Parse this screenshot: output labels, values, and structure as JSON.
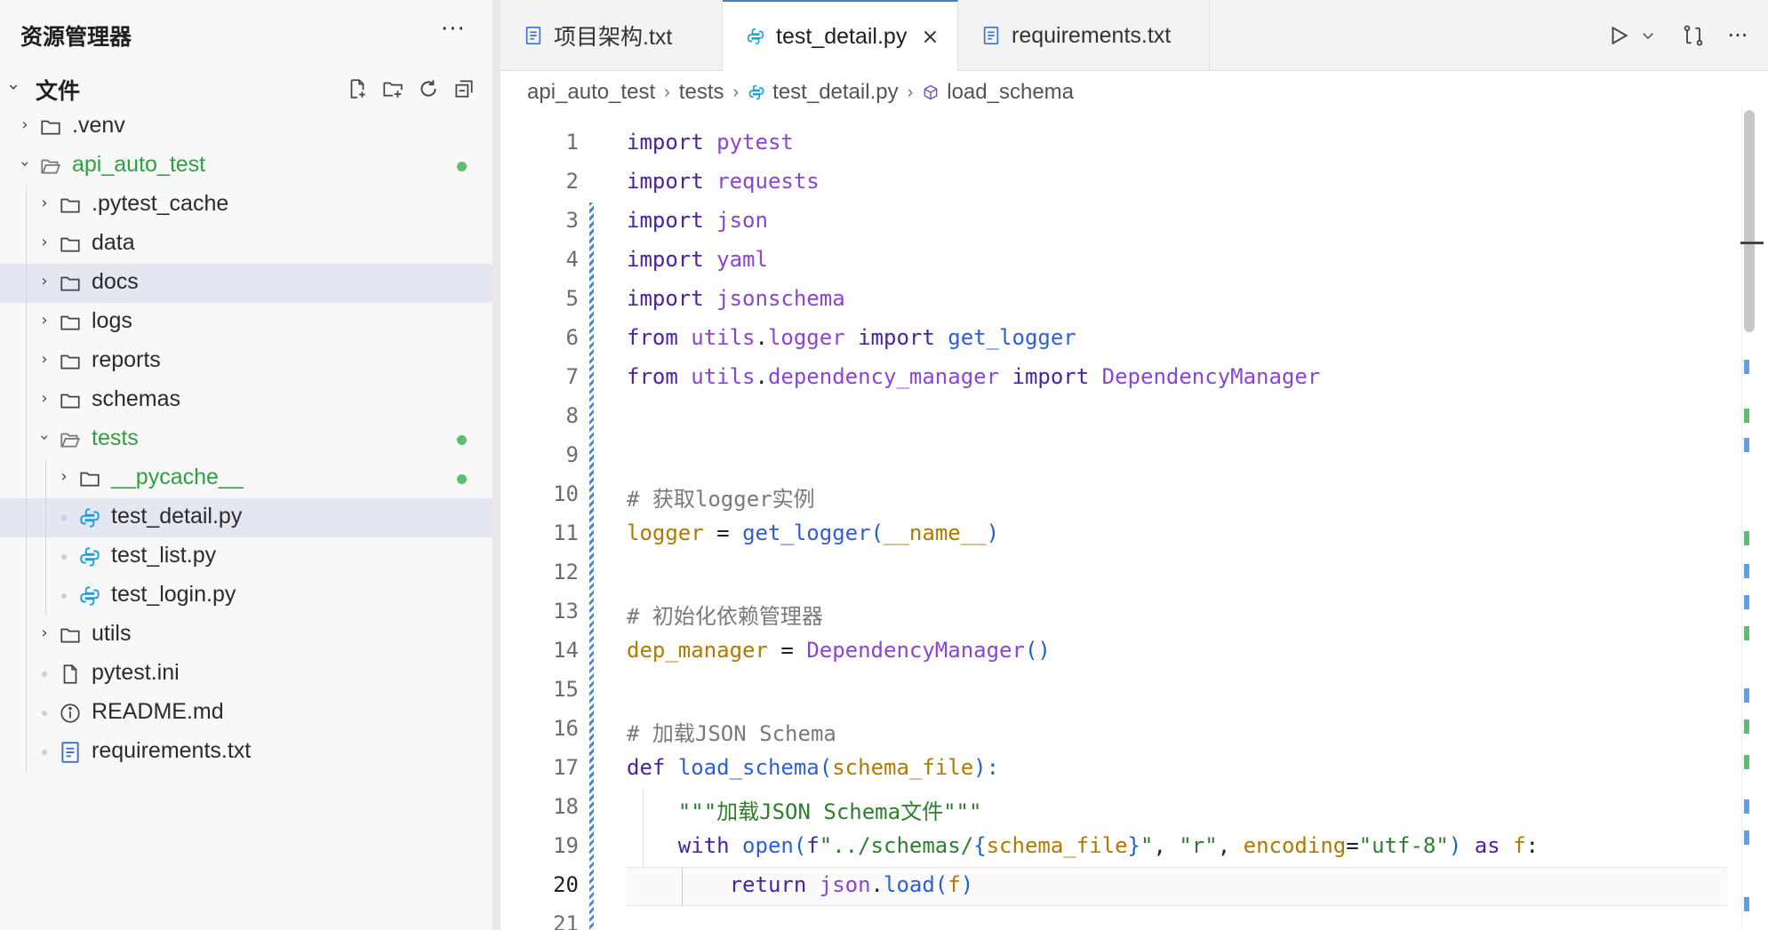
{
  "explorer": {
    "title": "资源管理器",
    "more": "···",
    "section_title": "文件",
    "actions": [
      "new-file",
      "new-folder",
      "refresh",
      "collapse-all"
    ]
  },
  "tree": [
    {
      "label": ".venv",
      "type": "folder",
      "depth": 0,
      "expanded": false,
      "status": false,
      "green": false
    },
    {
      "label": "api_auto_test",
      "type": "folder-open",
      "depth": 0,
      "expanded": true,
      "status": true,
      "green": true
    },
    {
      "label": ".pytest_cache",
      "type": "folder",
      "depth": 1,
      "expanded": false,
      "status": false,
      "green": false
    },
    {
      "label": "data",
      "type": "folder",
      "depth": 1,
      "expanded": false,
      "status": false,
      "green": false
    },
    {
      "label": "docs",
      "type": "folder",
      "depth": 1,
      "expanded": false,
      "status": false,
      "green": false,
      "selected": true
    },
    {
      "label": "logs",
      "type": "folder",
      "depth": 1,
      "expanded": false,
      "status": false,
      "green": false
    },
    {
      "label": "reports",
      "type": "folder",
      "depth": 1,
      "expanded": false,
      "status": false,
      "green": false
    },
    {
      "label": "schemas",
      "type": "folder",
      "depth": 1,
      "expanded": false,
      "status": false,
      "green": false
    },
    {
      "label": "tests",
      "type": "folder-open",
      "depth": 1,
      "expanded": true,
      "status": true,
      "green": true
    },
    {
      "label": "__pycache__",
      "type": "folder",
      "depth": 2,
      "expanded": false,
      "status": true,
      "green": true
    },
    {
      "label": "test_detail.py",
      "type": "python",
      "depth": 2,
      "status": false,
      "green": false,
      "selected": true
    },
    {
      "label": "test_list.py",
      "type": "python",
      "depth": 2,
      "status": false,
      "green": false
    },
    {
      "label": "test_login.py",
      "type": "python",
      "depth": 2,
      "status": false,
      "green": false
    },
    {
      "label": "utils",
      "type": "folder",
      "depth": 1,
      "expanded": false,
      "status": false,
      "green": false
    },
    {
      "label": "pytest.ini",
      "type": "file",
      "depth": 1,
      "status": false,
      "green": false
    },
    {
      "label": "README.md",
      "type": "info",
      "depth": 1,
      "status": false,
      "green": false
    },
    {
      "label": "requirements.txt",
      "type": "text",
      "depth": 1,
      "status": false,
      "green": false
    }
  ],
  "tabs": [
    {
      "label": "项目架构.txt",
      "icon": "text-file-icon",
      "active": false
    },
    {
      "label": "test_detail.py",
      "icon": "python-icon",
      "active": true,
      "close": "×"
    },
    {
      "label": "requirements.txt",
      "icon": "text-file-icon",
      "active": false
    }
  ],
  "breadcrumb": [
    {
      "label": "api_auto_test",
      "icon": ""
    },
    {
      "label": "tests",
      "icon": ""
    },
    {
      "label": "test_detail.py",
      "icon": "python-icon"
    },
    {
      "label": "load_schema",
      "icon": "cube-icon"
    }
  ],
  "editor": {
    "current_line": 20,
    "lines": [
      {
        "n": "1",
        "toks": [
          [
            "import",
            "k"
          ],
          [
            " ",
            "p"
          ],
          [
            "pytest",
            "m"
          ]
        ]
      },
      {
        "n": "2",
        "toks": [
          [
            "import",
            "k"
          ],
          [
            " ",
            "p"
          ],
          [
            "requests",
            "m"
          ]
        ]
      },
      {
        "n": "3",
        "toks": [
          [
            "import",
            "k"
          ],
          [
            " ",
            "p"
          ],
          [
            "json",
            "m"
          ]
        ]
      },
      {
        "n": "4",
        "toks": [
          [
            "import",
            "k"
          ],
          [
            " ",
            "p"
          ],
          [
            "yaml",
            "m"
          ]
        ]
      },
      {
        "n": "5",
        "toks": [
          [
            "import",
            "k"
          ],
          [
            " ",
            "p"
          ],
          [
            "jsonschema",
            "m"
          ]
        ]
      },
      {
        "n": "6",
        "toks": [
          [
            "from",
            "k"
          ],
          [
            " ",
            "p"
          ],
          [
            "utils",
            "m"
          ],
          [
            ".",
            "p"
          ],
          [
            "logger",
            "m"
          ],
          [
            " ",
            "p"
          ],
          [
            "import",
            "k"
          ],
          [
            " ",
            "p"
          ],
          [
            "get_logger",
            "f"
          ]
        ]
      },
      {
        "n": "7",
        "toks": [
          [
            "from",
            "k"
          ],
          [
            " ",
            "p"
          ],
          [
            "utils",
            "m"
          ],
          [
            ".",
            "p"
          ],
          [
            "dependency_manager",
            "m"
          ],
          [
            " ",
            "p"
          ],
          [
            "import",
            "k"
          ],
          [
            " ",
            "p"
          ],
          [
            "DependencyManager",
            "m"
          ]
        ]
      },
      {
        "n": "8",
        "toks": []
      },
      {
        "n": "9",
        "toks": []
      },
      {
        "n": "10",
        "toks": [
          [
            "# 获取logger实例",
            "c"
          ]
        ]
      },
      {
        "n": "11",
        "toks": [
          [
            "logger",
            "v"
          ],
          [
            " = ",
            "p"
          ],
          [
            "get_logger",
            "f"
          ],
          [
            "(",
            "b1"
          ],
          [
            "__name__",
            "v"
          ],
          [
            ")",
            "b1"
          ]
        ]
      },
      {
        "n": "12",
        "toks": []
      },
      {
        "n": "13",
        "toks": [
          [
            "# 初始化依赖管理器",
            "c"
          ]
        ]
      },
      {
        "n": "14",
        "toks": [
          [
            "dep_manager",
            "v"
          ],
          [
            " = ",
            "p"
          ],
          [
            "DependencyManager",
            "m"
          ],
          [
            "()",
            "b1"
          ]
        ]
      },
      {
        "n": "15",
        "toks": []
      },
      {
        "n": "16",
        "toks": [
          [
            "# 加载JSON Schema",
            "c"
          ]
        ]
      },
      {
        "n": "17",
        "toks": [
          [
            "def",
            "k"
          ],
          [
            " ",
            "p"
          ],
          [
            "load_schema",
            "f"
          ],
          [
            "(",
            "b1"
          ],
          [
            "schema_file",
            "v"
          ],
          [
            "):",
            "b1"
          ]
        ]
      },
      {
        "n": "18",
        "toks": [
          [
            "    ",
            "p"
          ],
          [
            "\"\"\"加载JSON Schema文件\"\"\"",
            "s"
          ]
        ]
      },
      {
        "n": "19",
        "toks": [
          [
            "    ",
            "p"
          ],
          [
            "with",
            "k"
          ],
          [
            " ",
            "p"
          ],
          [
            "open",
            "f"
          ],
          [
            "(",
            "b1"
          ],
          [
            "f",
            "k"
          ],
          [
            "\"../schemas/",
            "s"
          ],
          [
            "{",
            "b1"
          ],
          [
            "schema_file",
            "v"
          ],
          [
            "}",
            "b1"
          ],
          [
            "\"",
            "s"
          ],
          [
            ", ",
            "p"
          ],
          [
            "\"r\"",
            "s"
          ],
          [
            ", ",
            "p"
          ],
          [
            "encoding",
            "v"
          ],
          [
            "=",
            "p"
          ],
          [
            "\"utf-8\"",
            "s"
          ],
          [
            ")",
            "b1"
          ],
          [
            " ",
            "p"
          ],
          [
            "as",
            "k"
          ],
          [
            " ",
            "p"
          ],
          [
            "f",
            "v"
          ],
          [
            ":",
            "p"
          ]
        ]
      },
      {
        "n": "20",
        "toks": [
          [
            "        ",
            "p"
          ],
          [
            "return",
            "k"
          ],
          [
            " ",
            "p"
          ],
          [
            "json",
            "m"
          ],
          [
            ".",
            "p"
          ],
          [
            "load",
            "f"
          ],
          [
            "(",
            "b1"
          ],
          [
            "f",
            "v"
          ],
          [
            ")",
            "b1"
          ]
        ]
      },
      {
        "n": "21",
        "toks": []
      }
    ]
  },
  "colors": {
    "accent": "#4a7bd0",
    "git_added": "#5ebd6e",
    "git_modified": "#3c8be0",
    "selection": "#e4e6f1"
  }
}
